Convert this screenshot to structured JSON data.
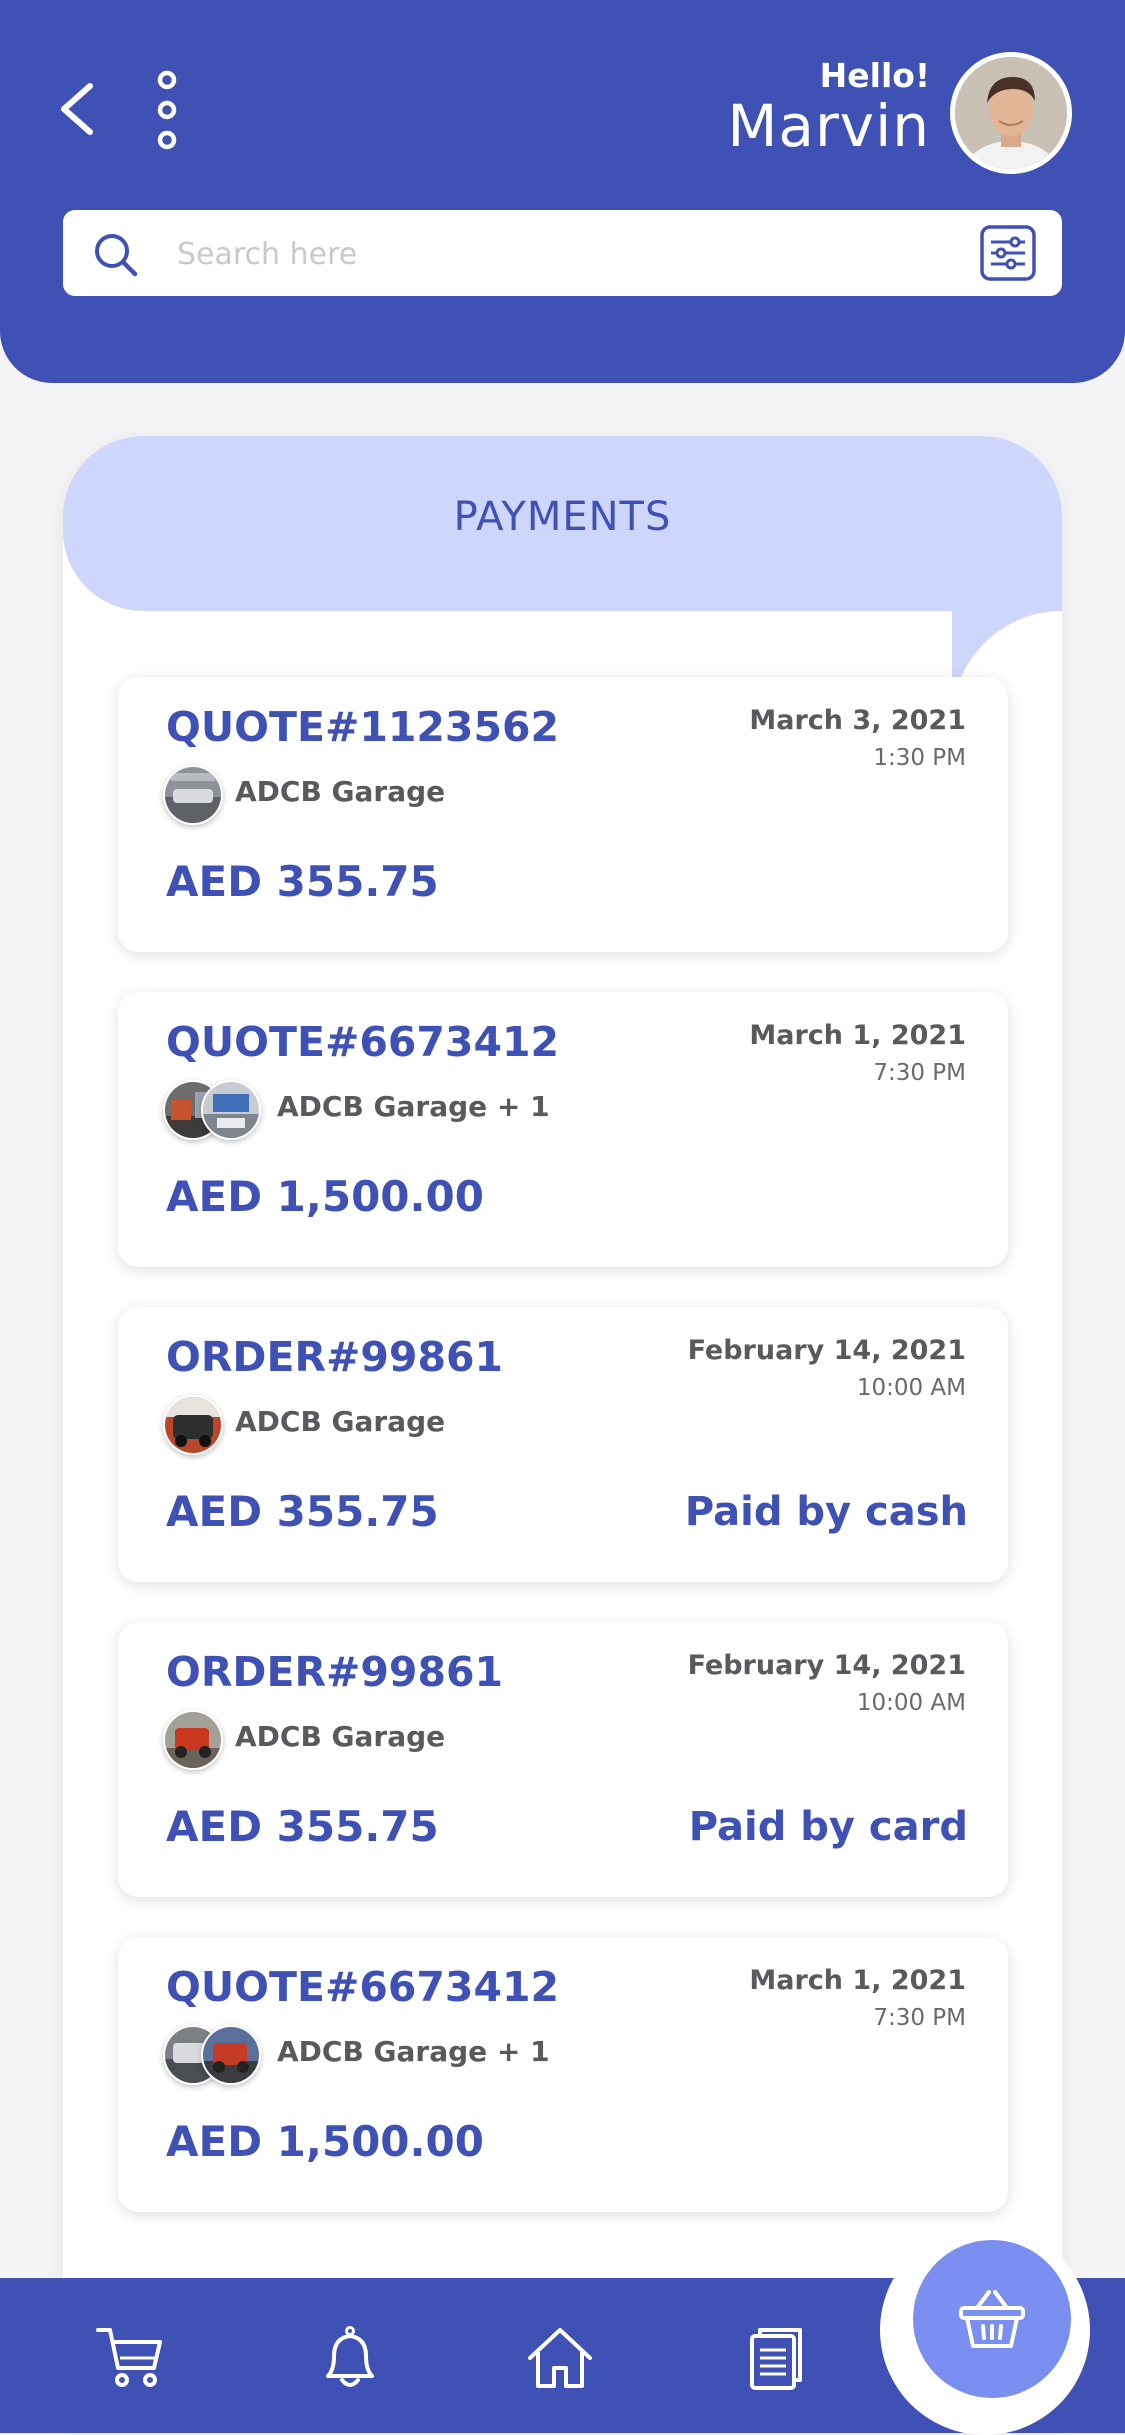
{
  "header": {
    "greeting": "Hello!",
    "user_name": "Marvin",
    "back_icon": "chevron-left-icon",
    "menu_icon": "more-vertical-icon"
  },
  "search": {
    "placeholder": "Search here",
    "value": "",
    "filter_icon": "sliders-icon"
  },
  "panel": {
    "title": "PAYMENTS"
  },
  "payments": [
    {
      "id": "QUOTE#1123562",
      "date": "March 3, 2021",
      "time": "1:30 PM",
      "garage": "ADCB Garage",
      "amount": "AED 355.75",
      "method": ""
    },
    {
      "id": "QUOTE#6673412",
      "date": "March 1, 2021",
      "time": "7:30 PM",
      "garage": "ADCB Garage + 1",
      "amount": "AED 1,500.00",
      "method": ""
    },
    {
      "id": "ORDER#99861",
      "date": "February 14, 2021",
      "time": "10:00 AM",
      "garage": "ADCB Garage",
      "amount": "AED 355.75",
      "method": "Paid by cash"
    },
    {
      "id": "ORDER#99861",
      "date": "February 14, 2021",
      "time": "10:00 AM",
      "garage": "ADCB Garage",
      "amount": "AED 355.75",
      "method": "Paid by card"
    },
    {
      "id": "QUOTE#6673412",
      "date": "March 1, 2021",
      "time": "7:30 PM",
      "garage": "ADCB Garage + 1",
      "amount": "AED 1,500.00",
      "method": ""
    }
  ],
  "bottom_nav": {
    "items": [
      "cart-icon",
      "bell-icon",
      "home-icon",
      "document-icon"
    ],
    "fab_icon": "basket-icon"
  },
  "colors": {
    "primary": "#3f51b5",
    "panel_band": "#cfd6fb",
    "fab": "#7b8ff0"
  }
}
